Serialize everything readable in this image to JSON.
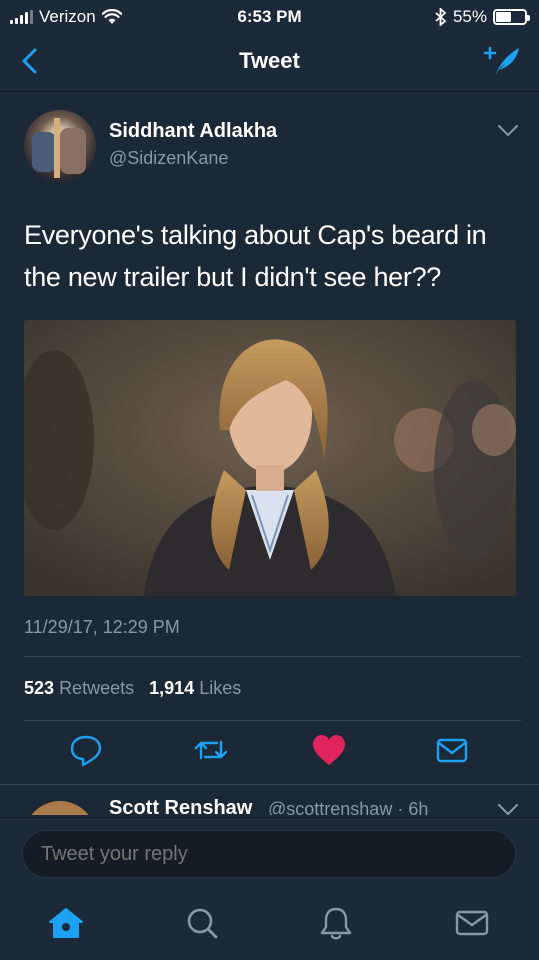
{
  "status_bar": {
    "carrier": "Verizon",
    "time": "6:53 PM",
    "battery_percent": "55%",
    "battery_level": 0.55
  },
  "nav": {
    "title": "Tweet"
  },
  "tweet": {
    "author_name": "Siddhant Adlakha",
    "author_handle": "@SidizenKane",
    "text": "Everyone's talking about Cap's beard in the new trailer but I didn't see her??",
    "timestamp": "11/29/17, 12:29 PM",
    "retweets_count": "523",
    "retweets_label": "Retweets",
    "likes_count": "1,914",
    "likes_label": "Likes",
    "liked": true
  },
  "reply_preview": {
    "name": "Scott Renshaw",
    "meta": "@scottrenshaw · 6h"
  },
  "reply_bar": {
    "placeholder": "Tweet your reply"
  },
  "tab_bar": {
    "items": [
      "home-icon",
      "search-icon",
      "notifications-icon",
      "messages-icon"
    ],
    "active": "home-icon"
  },
  "colors": {
    "background": "#1b2836",
    "accent": "#1da1f2",
    "like": "#e0245e",
    "muted_text": "#8899a6"
  }
}
